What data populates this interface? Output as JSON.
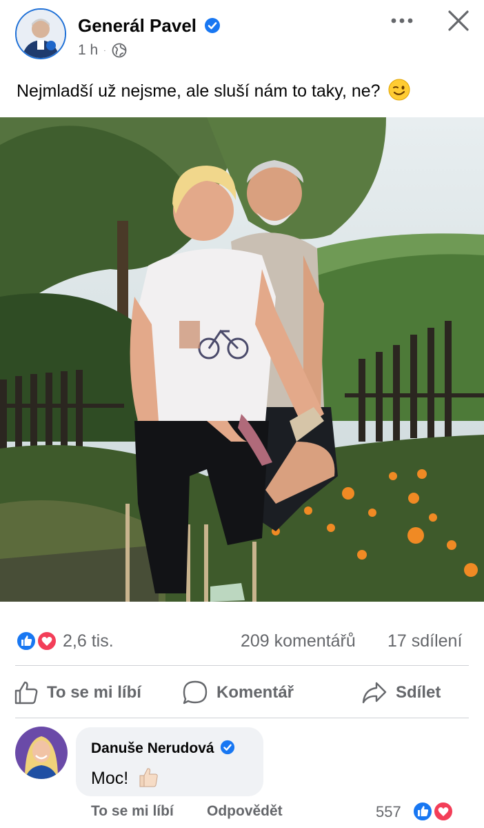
{
  "post": {
    "author": "Generál Pavel",
    "time": "1 h",
    "audience_icon": "globe-icon",
    "text": "Nejmladší už nejsme, ale sluší nám to taky, ne?",
    "text_emoji": "winking-face-emoji"
  },
  "stats": {
    "reactions": "2,6 tis.",
    "comments": "209 komentářů",
    "shares": "17 sdílení"
  },
  "actions": {
    "like": "To se mi líbí",
    "comment": "Komentář",
    "share": "Sdílet"
  },
  "comment": {
    "author": "Danuše Nerudová",
    "text": "Moc!",
    "emoji": "thumbs-up-emoji",
    "like": "To se mi líbí",
    "reply": "Odpovědět",
    "reaction_count": "557"
  },
  "colors": {
    "accent": "#1877f2",
    "love": "#f33e58",
    "secondary_text": "#65676b",
    "bubble": "#f0f2f5"
  }
}
